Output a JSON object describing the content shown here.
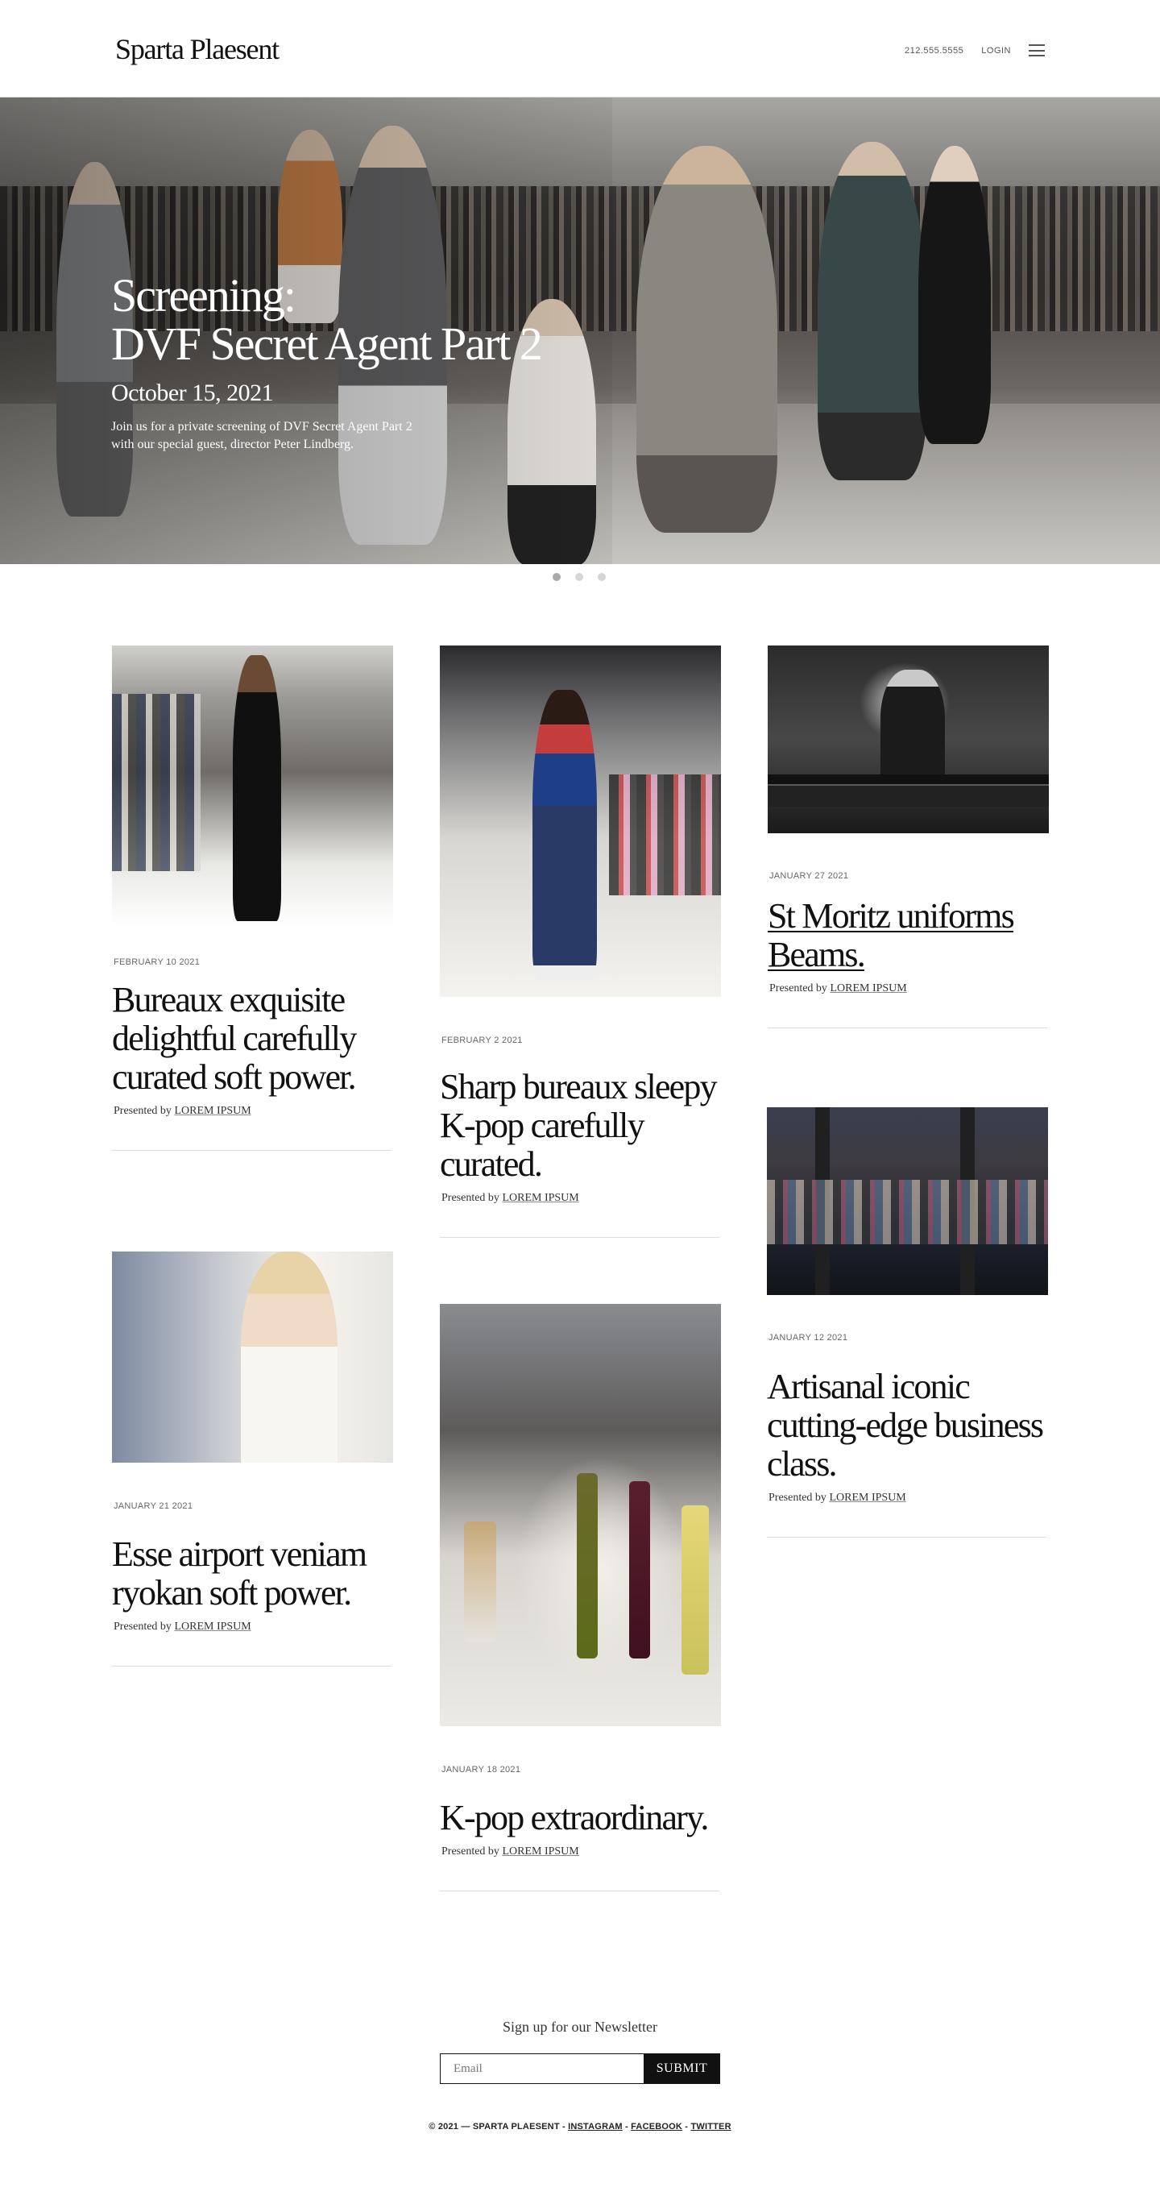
{
  "header": {
    "logo": "Sparta Plaesent",
    "phone": "212.555.5555",
    "login": "LOGIN",
    "menu_icon": "hamburger-menu-icon"
  },
  "hero": {
    "title_line1": "Screening:",
    "title_line2": "DVF Secret Agent Part 2",
    "date": "October 15, 2021",
    "desc_line1": "Join us for a private screening of DVF Secret Agent Part 2",
    "desc_line2": "with our special guest, director Peter Lindberg.",
    "slides": 3,
    "active_slide": 1
  },
  "cards": [
    {
      "date": "FEBRUARY 10 2021",
      "title": "Bureaux exquisite delightful carefully curated soft power.",
      "presented": "Presented by",
      "sponsor": "LOREM IPSUM"
    },
    {
      "date": "FEBRUARY 2 2021",
      "title": "Sharp bureaux sleepy K-pop carefully curated.",
      "presented": "Presented by",
      "sponsor": "LOREM IPSUM"
    },
    {
      "date": "JANUARY 27 2021",
      "title": "St Moritz uniforms Beams.",
      "presented": "Presented by",
      "sponsor": "LOREM IPSUM"
    },
    {
      "date": "JANUARY 21 2021",
      "title": "Esse airport veniam ryokan soft power.",
      "presented": "Presented by",
      "sponsor": "LOREM IPSUM"
    },
    {
      "date": "JANUARY 18 2021",
      "title": "K-pop extraordinary.",
      "presented": "Presented by",
      "sponsor": "LOREM IPSUM"
    },
    {
      "date": "JANUARY 12 2021",
      "title": "Artisanal iconic cutting-edge business class.",
      "presented": "Presented by",
      "sponsor": "LOREM IPSUM"
    }
  ],
  "newsletter": {
    "label": "Sign up for our Newsletter",
    "placeholder": "Email",
    "submit": "SUBMIT"
  },
  "footer": {
    "copyright": "© 2021 — SPARTA PLAESENT - ",
    "instagram": "INSTAGRAM",
    "sep1": " - ",
    "facebook": "FACEBOOK",
    "sep2": " - ",
    "twitter": "TWITTER"
  }
}
